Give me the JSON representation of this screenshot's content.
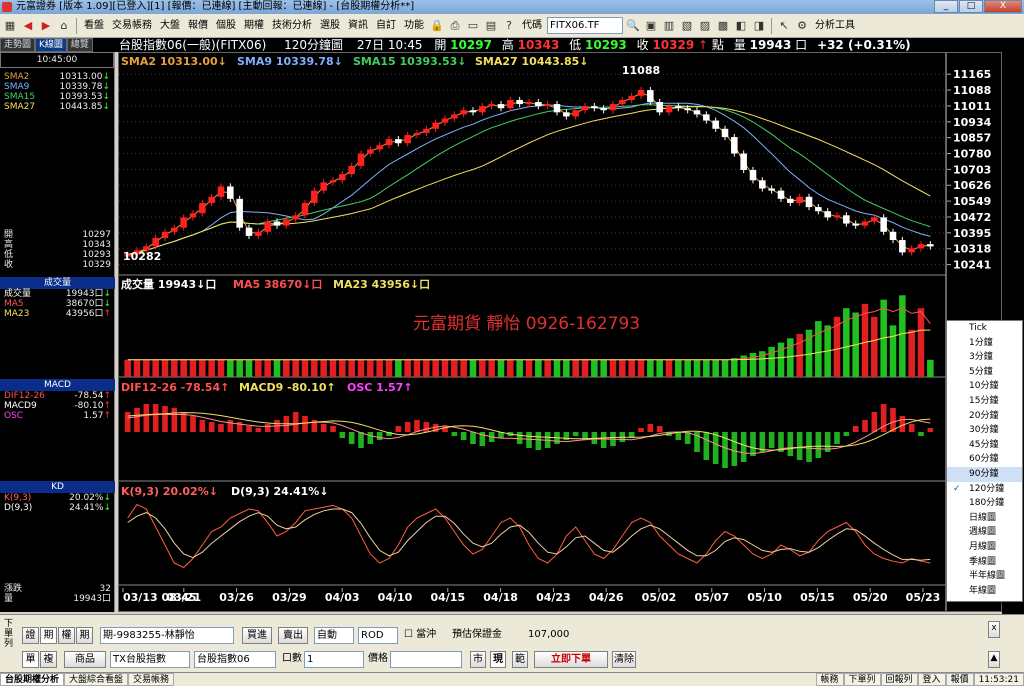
{
  "window": {
    "title": "元富證券 [版本 1.09][已登入][1] [報價：已連線] [主動回報：已連線] - [台股期權分析**]",
    "buttons": [
      "_",
      "□",
      "X"
    ]
  },
  "menu": {
    "items": [
      "看盤",
      "交易帳務",
      "大盤",
      "報價",
      "個股",
      "期權",
      "技術分析",
      "選股",
      "資訊",
      "自訂",
      "功能"
    ],
    "code_label": "代碼",
    "code_value": "FITX06.TF",
    "analysis_tools": "分析工具"
  },
  "sidetabs": [
    "走勢圖",
    "K線圖",
    "總覽"
  ],
  "header": {
    "name": "台股指數06(一般)(FITX06)",
    "period": "120分鐘圖",
    "date_time": "27日 10:45",
    "open_label": "開",
    "open": "10297",
    "high_label": "高",
    "high": "10343",
    "low_label": "低",
    "low": "10293",
    "close_label": "收",
    "close": "10329",
    "unit": "點",
    "vol_label": "量",
    "vol": "19943",
    "vol_unit": "口",
    "change": "+32 (+0.31%)"
  },
  "left": {
    "time": "10:45:00",
    "sma": [
      {
        "name": "SMA2",
        "value": "10313.00",
        "arrow": "↓",
        "color": "#e8a040"
      },
      {
        "name": "SMA9",
        "value": "10339.78",
        "arrow": "↓",
        "color": "#7fb0ff"
      },
      {
        "name": "SMA15",
        "value": "10393.53",
        "arrow": "↓",
        "color": "#40d060"
      },
      {
        "name": "SMA27",
        "value": "10443.85",
        "arrow": "↓",
        "color": "#f0e060"
      }
    ],
    "ohlc": [
      {
        "label": "開",
        "value": "10297"
      },
      {
        "label": "高",
        "value": "10343"
      },
      {
        "label": "低",
        "value": "10293"
      },
      {
        "label": "收",
        "value": "10329"
      }
    ],
    "vol_head": "成交量",
    "vol_rows": [
      {
        "name": "成交量",
        "value": "19943口",
        "arrow": "↓",
        "color": "#ffffff"
      },
      {
        "name": "MA5",
        "value": "38670口",
        "arrow": "↓",
        "color": "#ff5050"
      },
      {
        "name": "MA23",
        "value": "43956口",
        "arrow": "↑",
        "color": "#f0e060"
      }
    ],
    "macd_head": "MACD",
    "macd_rows": [
      {
        "name": "DIF12-26",
        "value": "-78.54",
        "arrow": "↑",
        "color": "#ff5050"
      },
      {
        "name": "MACD9",
        "value": "-80.10",
        "arrow": "↑",
        "color": "#ffffff"
      },
      {
        "name": "OSC",
        "value": "1.57",
        "arrow": "↑",
        "color": "#ff40ff"
      }
    ],
    "kd_head": "KD",
    "kd_rows": [
      {
        "name": "K(9,3)",
        "value": "20.02%",
        "arrow": "↓",
        "color": "#ff6060"
      },
      {
        "name": "D(9,3)",
        "value": "24.41%",
        "arrow": "↓",
        "color": "#ffffff"
      }
    ],
    "bottom_rows": [
      {
        "label": "漲跌",
        "value": "32"
      },
      {
        "label": "量",
        "value": "19943口"
      }
    ]
  },
  "chart_data": [
    {
      "type": "candlestick",
      "title": "台股指數06(一般)(FITX06) 120分鐘圖",
      "legend": [
        {
          "name": "SMA2",
          "value": "10313.00",
          "arrow": "↓",
          "color": "#e8a040"
        },
        {
          "name": "SMA9",
          "value": "10339.78",
          "arrow": "↓",
          "color": "#7fb0ff"
        },
        {
          "name": "SMA15",
          "value": "10393.53",
          "arrow": "↓",
          "color": "#40d060"
        },
        {
          "name": "SMA27",
          "value": "10443.85",
          "arrow": "↓",
          "color": "#f0e060"
        }
      ],
      "y_ticks": [
        "11165",
        "11088",
        "11011",
        "10934",
        "10857",
        "10780",
        "10703",
        "10626",
        "10549",
        "10472",
        "10395",
        "10318",
        "10241"
      ],
      "ylim": [
        10200,
        11200
      ],
      "annotations": [
        {
          "text": "11088"
        },
        {
          "text": "10282"
        }
      ],
      "x_ticks": [
        "03/13 08:45",
        "03/21",
        "03/26",
        "03/29",
        "04/03",
        "04/10",
        "04/15",
        "04/18",
        "04/23",
        "04/26",
        "05/02",
        "05/07",
        "05/10",
        "05/15",
        "05/20",
        "05/23"
      ],
      "close": [
        10290,
        10310,
        10330,
        10370,
        10400,
        10420,
        10470,
        10490,
        10540,
        10570,
        10620,
        10560,
        10420,
        10380,
        10400,
        10450,
        10430,
        10460,
        10480,
        10540,
        10600,
        10640,
        10650,
        10680,
        10720,
        10780,
        10800,
        10820,
        10850,
        10830,
        10870,
        10880,
        10900,
        10930,
        10950,
        10970,
        10990,
        10980,
        11010,
        11020,
        11000,
        11040,
        11020,
        11030,
        11010,
        11020,
        10980,
        10960,
        10990,
        11010,
        11000,
        10990,
        11020,
        11040,
        11060,
        11088,
        11030,
        10980,
        11010,
        11000,
        10990,
        10970,
        10940,
        10900,
        10860,
        10780,
        10700,
        10650,
        10610,
        10600,
        10560,
        10540,
        10570,
        10520,
        10500,
        10470,
        10480,
        10440,
        10430,
        10450,
        10470,
        10400,
        10360,
        10300,
        10320,
        10340,
        10329
      ]
    },
    {
      "type": "bar",
      "title": "成交量",
      "legend": [
        {
          "name": "成交量",
          "value": "19943",
          "arrow": "↓",
          "unit": "口",
          "color": "#ffffff"
        },
        {
          "name": "MA5",
          "value": "38670",
          "arrow": "↓",
          "unit": "口",
          "color": "#ff5050"
        },
        {
          "name": "MA23",
          "value": "43956",
          "arrow": "↓",
          "unit": "口",
          "color": "#f0e060"
        }
      ],
      "values": [
        20,
        20,
        20,
        20,
        20,
        20,
        20,
        20,
        20,
        20,
        20,
        20,
        20,
        20,
        20,
        20,
        20,
        20,
        20,
        20,
        20,
        20,
        20,
        20,
        20,
        20,
        20,
        20,
        20,
        20,
        20,
        20,
        20,
        20,
        20,
        20,
        20,
        20,
        20,
        20,
        20,
        20,
        20,
        20,
        20,
        20,
        20,
        20,
        20,
        20,
        20,
        20,
        20,
        20,
        20,
        20,
        20,
        20,
        20,
        20,
        20,
        20,
        20,
        20,
        20,
        22,
        25,
        28,
        30,
        35,
        40,
        45,
        50,
        55,
        65,
        60,
        70,
        80,
        75,
        85,
        70,
        90,
        60,
        95,
        55,
        80,
        20
      ]
    },
    {
      "type": "bar",
      "title": "MACD",
      "legend": [
        {
          "name": "DIF12-26",
          "value": "-78.54",
          "arrow": "↑",
          "color": "#ff5050"
        },
        {
          "name": "MACD9",
          "value": "-80.10",
          "arrow": "↑",
          "color": "#f0e060"
        },
        {
          "name": "OSC",
          "value": "1.57",
          "arrow": "↑",
          "color": "#ff40ff"
        }
      ],
      "osc": [
        10,
        12,
        14,
        14,
        13,
        12,
        10,
        8,
        6,
        5,
        4,
        6,
        5,
        3,
        2,
        4,
        6,
        8,
        10,
        8,
        6,
        4,
        3,
        -3,
        -6,
        -8,
        -6,
        -4,
        -2,
        3,
        5,
        6,
        5,
        4,
        3,
        -2,
        -4,
        -6,
        -7,
        -5,
        -3,
        -2,
        -6,
        -8,
        -9,
        -8,
        -6,
        -4,
        -2,
        -4,
        -6,
        -8,
        -7,
        -5,
        -3,
        2,
        4,
        3,
        -2,
        -4,
        -6,
        -10,
        -14,
        -16,
        -18,
        -17,
        -15,
        -12,
        -10,
        -8,
        -10,
        -12,
        -14,
        -15,
        -13,
        -10,
        -6,
        -2,
        3,
        6,
        10,
        14,
        12,
        8,
        4,
        -2,
        2
      ]
    },
    {
      "type": "line",
      "title": "KD",
      "legend": [
        {
          "name": "K(9,3)",
          "value": "20.02%",
          "arrow": "↓",
          "color": "#ff6060"
        },
        {
          "name": "D(9,3)",
          "value": "24.41%",
          "arrow": "↓",
          "color": "#ffffff"
        }
      ],
      "k": [
        70,
        85,
        80,
        60,
        40,
        20,
        15,
        25,
        40,
        55,
        60,
        70,
        75,
        80,
        78,
        65,
        50,
        55,
        65,
        78,
        80,
        82,
        84,
        80,
        70,
        50,
        30,
        20,
        25,
        40,
        60,
        70,
        75,
        80,
        70,
        55,
        40,
        30,
        35,
        50,
        65,
        70,
        60,
        40,
        25,
        20,
        30,
        50,
        60,
        45,
        30,
        25,
        35,
        50,
        65,
        70,
        65,
        50,
        40,
        30,
        25,
        20,
        30,
        45,
        55,
        50,
        40,
        30,
        25,
        30,
        40,
        35,
        28,
        32,
        45,
        55,
        60,
        65,
        55,
        40,
        30,
        25,
        22,
        20,
        25,
        22,
        20
      ],
      "d": [
        65,
        72,
        76,
        70,
        58,
        42,
        30,
        26,
        32,
        42,
        50,
        58,
        66,
        72,
        76,
        72,
        62,
        58,
        60,
        68,
        74,
        78,
        80,
        80,
        76,
        64,
        48,
        34,
        28,
        32,
        45,
        55,
        65,
        72,
        72,
        64,
        52,
        42,
        38,
        42,
        52,
        60,
        62,
        54,
        42,
        32,
        30,
        38,
        48,
        50,
        42,
        34,
        32,
        40,
        50,
        58,
        62,
        58,
        50,
        42,
        34,
        28,
        28,
        34,
        44,
        48,
        46,
        40,
        34,
        32,
        35,
        36,
        33,
        32,
        37,
        45,
        52,
        58,
        57,
        50,
        42,
        35,
        29,
        24,
        24,
        23,
        24
      ]
    }
  ],
  "watermark": "元富期貨 靜怡 0926-162793",
  "period_menu": {
    "items": [
      "Tick",
      "1分鐘",
      "3分鐘",
      "5分鐘",
      "10分鐘",
      "15分鐘",
      "20分鐘",
      "30分鐘",
      "45分鐘",
      "60分鐘",
      "90分鐘",
      "120分鐘",
      "180分鐘",
      "日線圖",
      "週線圖",
      "月線圖",
      "季線圖",
      "半年線圖",
      "年線圖"
    ],
    "highlight": "90分鐘",
    "checked": "120分鐘"
  },
  "order": {
    "tabs_top": [
      "證",
      "期",
      "權",
      "期"
    ],
    "tabs_bottom": [
      "單",
      "複"
    ],
    "account": "期-9983255-林靜怡",
    "buy": "買進",
    "sell": "賣出",
    "mode": "自動",
    "rod": "ROD",
    "offset": "當沖",
    "margin_label": "預估保證金",
    "margin_value": "107,000",
    "product_label": "商品",
    "product": "TX台股指數",
    "contract": "台股指數06",
    "lots_label": "口數",
    "lots": "1",
    "price_label": "價格",
    "market": "市",
    "current": "現",
    "range": "範",
    "submit": "立即下單",
    "clear": "清除",
    "side_label": "下單列"
  },
  "status": {
    "tabs": [
      "台股期權分析",
      "大盤綜合看盤",
      "交易帳務"
    ],
    "right_items": [
      "帳務",
      "下單列",
      "回報列",
      "登入",
      "報價",
      "11:53:21"
    ]
  }
}
